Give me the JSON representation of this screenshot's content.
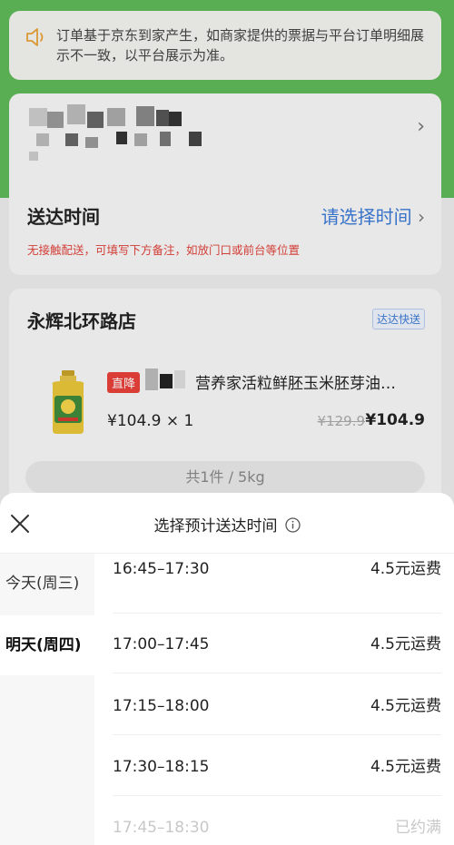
{
  "notice": {
    "icon": "speaker-icon",
    "text": "订单基于京东到家产生，如商家提供的票据与平台订单明细展示不一致，以平台展示为准。"
  },
  "delivery": {
    "label": "送达时间",
    "action": "请选择时间",
    "note": "无接触配送，可填写下方备注，如放门口或前台等位置"
  },
  "store": {
    "name": "永辉北环路店",
    "badge": "达达快送",
    "product": {
      "tag": "直降",
      "name": "营养家活粒鲜胚玉米胚芽油…",
      "qty_price": "¥104.9 × 1",
      "original_price": "¥129.9",
      "price": "¥104.9"
    },
    "summary": "共1件 / 5kg"
  },
  "sheet": {
    "title": "选择预计送达时间",
    "days": [
      {
        "label": "今天(周三)",
        "active": false
      },
      {
        "label": "明天(周四)",
        "active": true
      }
    ],
    "slots": [
      {
        "time": "16:45–17:30",
        "fee": "4.5元运费",
        "full": false
      },
      {
        "time": "17:00–17:45",
        "fee": "4.5元运费",
        "full": false
      },
      {
        "time": "17:15–18:00",
        "fee": "4.5元运费",
        "full": false
      },
      {
        "time": "17:30–18:15",
        "fee": "4.5元运费",
        "full": false
      },
      {
        "time": "17:45–18:30",
        "fee": "已约满",
        "full": true
      }
    ]
  },
  "colors": {
    "green": "#5fb95a",
    "link_blue": "#3d7bd6",
    "alert_red": "#e0433c",
    "tag_red": "#e8403a"
  }
}
